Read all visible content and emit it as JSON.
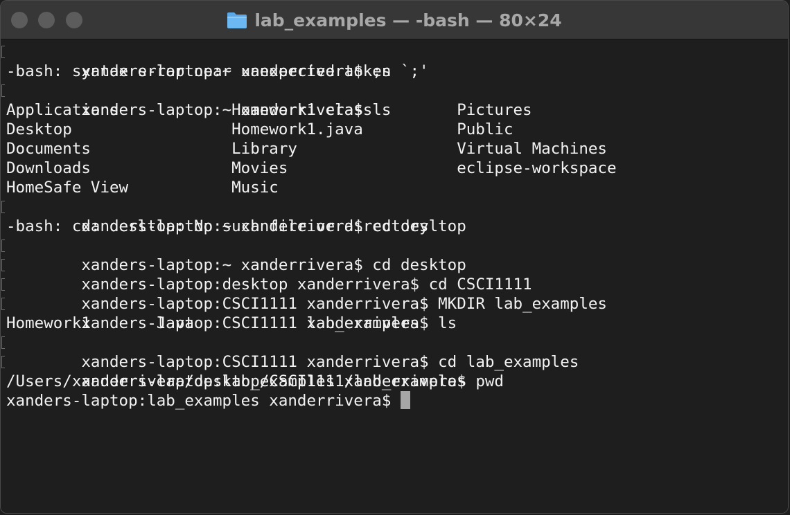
{
  "window": {
    "title": "lab_examples — -bash — 80×24",
    "folder_icon": "folder-icon"
  },
  "colors": {
    "background": "#1e1e1e",
    "titlebar": "#373737",
    "text": "#f2f2f2",
    "title_text": "#a8a8a8",
    "cursor": "#a6a6a6"
  },
  "terminal": {
    "lines": [
      "xanders-laptop:~ xanderrivera$ ;s",
      "-bash: syntax error near unexpected token `;'",
      "xanders-laptop:~ xanderrivera$ ls",
      "Applications            Homework1.class         Pictures",
      "Desktop                 Homework1.java          Public",
      "Documents               Library                 Virtual Machines",
      "Downloads               Movies                  eclipse-workspace",
      "HomeSafe View           Music",
      "xanders-laptop:~ xanderrivera$ cd desltop",
      "-bash: cd: desltop: No such file or directory",
      "xanders-laptop:~ xanderrivera$ cd desktop",
      "xanders-laptop:desktop xanderrivera$ cd CSCI1111",
      "xanders-laptop:CSCI1111 xanderrivera$ MKDIR lab_examples",
      "xanders-laptop:CSCI1111 xanderrivera$ ls",
      "Homework1       Java            lab_examples",
      "xanders-laptop:CSCI1111 xanderrivera$ cd lab_examples",
      "xanders-laptop:lab_examples xanderrivera$ pwd",
      "/Users/xanderrivera/desktop/CSCI1111/lab_examples"
    ],
    "prompt": "xanders-laptop:lab_examples xanderrivera$ "
  }
}
